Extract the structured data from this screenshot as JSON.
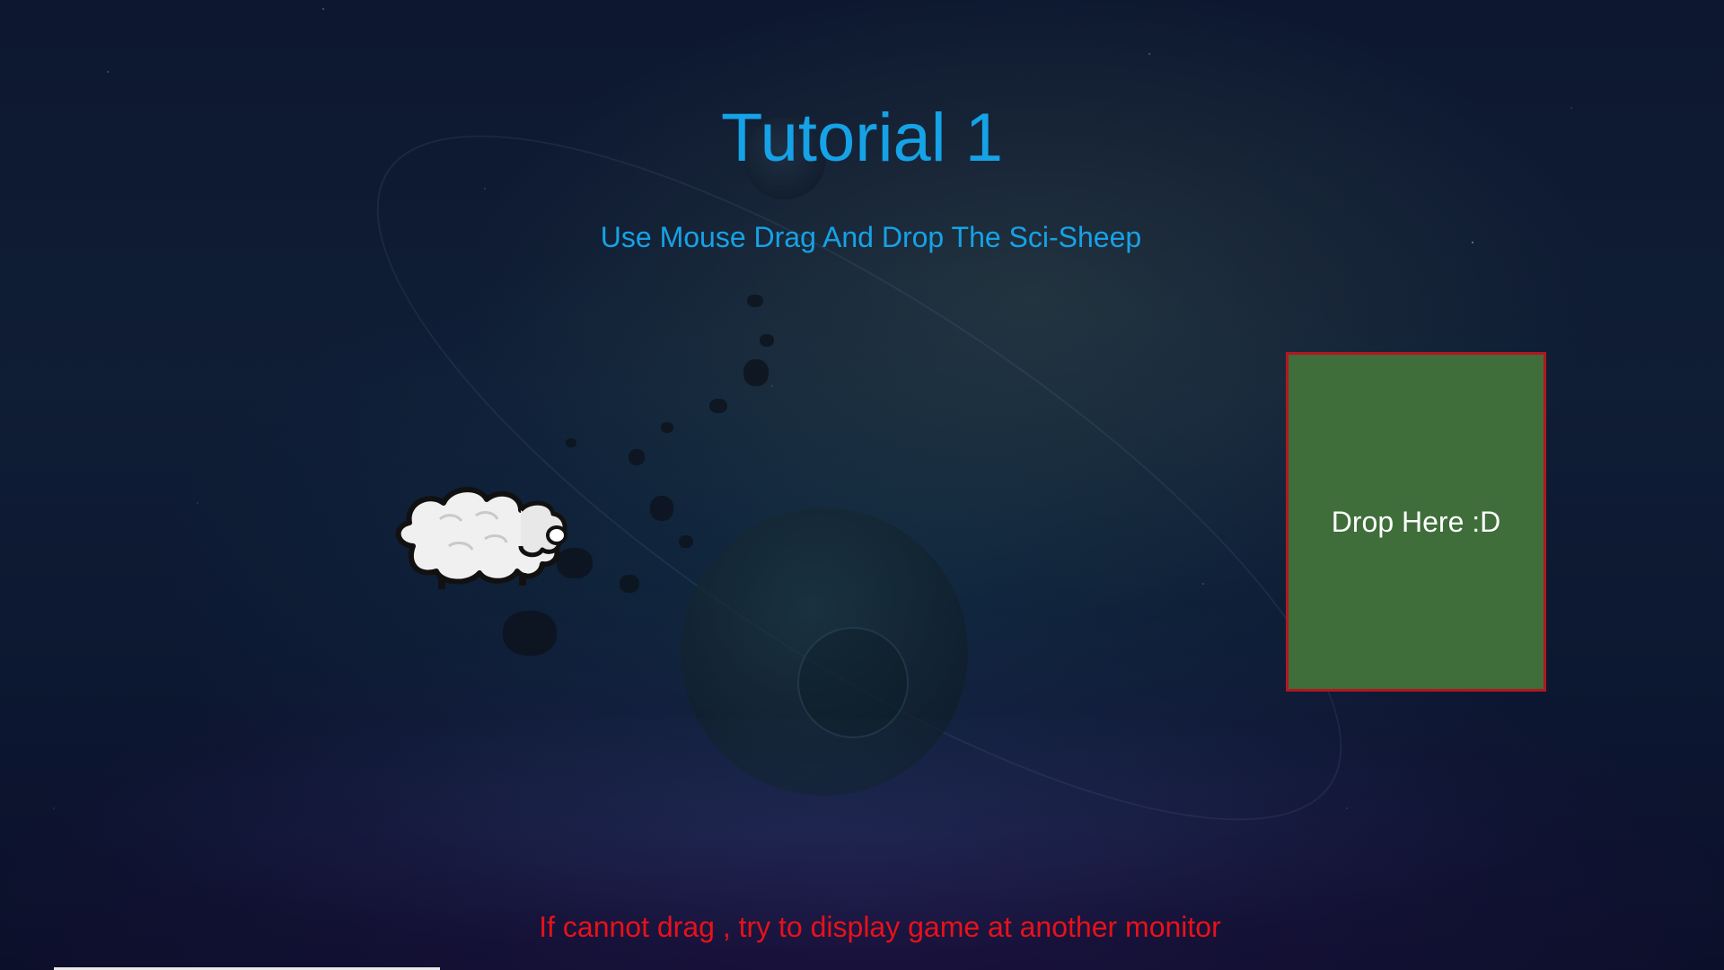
{
  "title": "Tutorial 1",
  "subtitle": "Use Mouse Drag And Drop The Sci-Sheep",
  "dropzone": {
    "label": "Drop Here :D",
    "fill_color": "#3f6e3a",
    "border_color": "#b3171f"
  },
  "sheep": {
    "icon": "sheep-icon"
  },
  "warning": "If cannot drag , try to display game at another monitor",
  "colors": {
    "title": "#16a2e6",
    "warning": "#e8111a"
  }
}
